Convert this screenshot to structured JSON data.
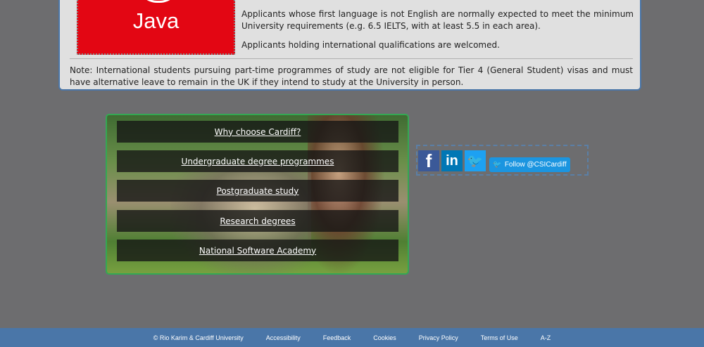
{
  "colors": {
    "accent": "#4a76a8",
    "java_red": "#e30613",
    "green_border": "#34a853",
    "twitter": "#1b95e0"
  },
  "info_panel": {
    "logo_text": "Java",
    "paragraph_english": "Applicants whose first language is not English are normally expected to meet the minimum University requirements (e.g. 6.5 IELTS, with at least 5.5 in each area).",
    "paragraph_international": "Applicants holding international qualifications are welcomed.",
    "note": "Note: International students pursuing part-time programmes of study are not eligible for Tier 4 (General Student) visas and must have alternative leave to remain in the UK if they intend to study at the University in person."
  },
  "nav_links": [
    {
      "label": "Why choose Cardiff?"
    },
    {
      "label": "Undergraduate degree programmes"
    },
    {
      "label": "Postgraduate study"
    },
    {
      "label": "Research degrees"
    },
    {
      "label": "National Software Academy"
    }
  ],
  "social": {
    "facebook": "f",
    "linkedin": "in",
    "twitter": "🐦",
    "follow_label": "Follow @CSICardiff",
    "icons": [
      "facebook-icon",
      "linkedin-icon",
      "twitter-icon"
    ]
  },
  "footer": {
    "copyright": "© Rio Karim & Cardiff University",
    "links": [
      "Accessibility",
      "Feedback",
      "Cookies",
      "Privacy Policy",
      "Terms of Use",
      "A-Z"
    ]
  }
}
